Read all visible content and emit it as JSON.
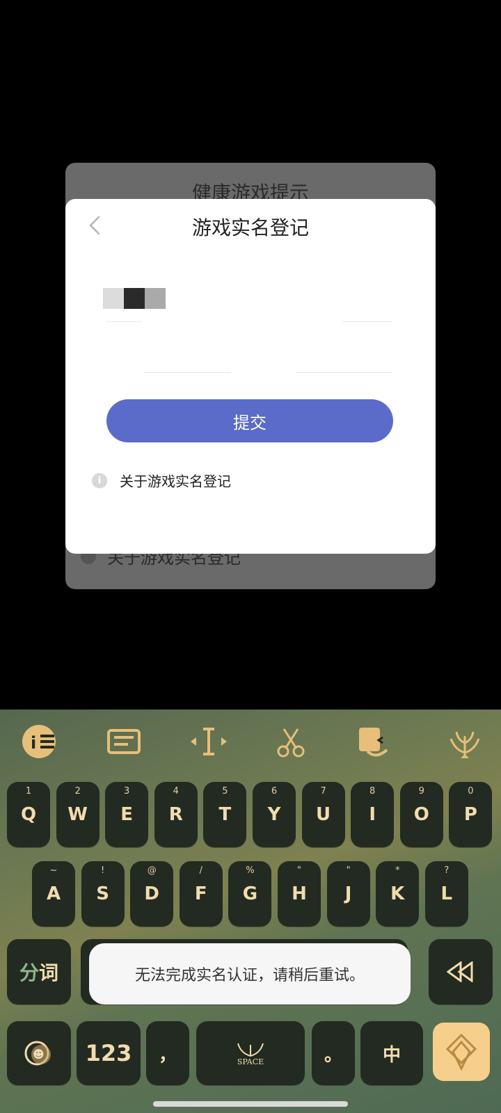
{
  "background_dialog": {
    "title": "健康游戏提示",
    "bottom_text": "关于游戏实名登记"
  },
  "modal": {
    "title": "游戏实名登记",
    "submit_label": "提交",
    "info_link": "关于游戏实名登记"
  },
  "keyboard": {
    "row1": [
      {
        "sup": "1",
        "key": "Q"
      },
      {
        "sup": "2",
        "key": "W"
      },
      {
        "sup": "3",
        "key": "E"
      },
      {
        "sup": "4",
        "key": "R"
      },
      {
        "sup": "5",
        "key": "T"
      },
      {
        "sup": "6",
        "key": "Y"
      },
      {
        "sup": "7",
        "key": "U"
      },
      {
        "sup": "8",
        "key": "I"
      },
      {
        "sup": "9",
        "key": "O"
      },
      {
        "sup": "0",
        "key": "P"
      }
    ],
    "row2": [
      {
        "sup": "~",
        "key": "A"
      },
      {
        "sup": "!",
        "key": "S"
      },
      {
        "sup": "@",
        "key": "D"
      },
      {
        "sup": "/",
        "key": "F"
      },
      {
        "sup": "%",
        "key": "G"
      },
      {
        "sup": "\"",
        "key": "H"
      },
      {
        "sup": "\"",
        "key": "J"
      },
      {
        "sup": "*",
        "key": "K"
      },
      {
        "sup": "?",
        "key": "L"
      }
    ],
    "fenci_fen": "分",
    "fenci_ci": "词",
    "num_label": "123",
    "comma_label": "，",
    "space_label": "SPACE",
    "period_label": "。",
    "zh_label": "中"
  },
  "toast": {
    "message": "无法完成实名认证，请稍后重试。"
  },
  "colors": {
    "accent_button": "#5b6bc9",
    "key_bg": "#232a22",
    "key_text": "#f2dcae",
    "enter_key": "#f6cf8c"
  }
}
